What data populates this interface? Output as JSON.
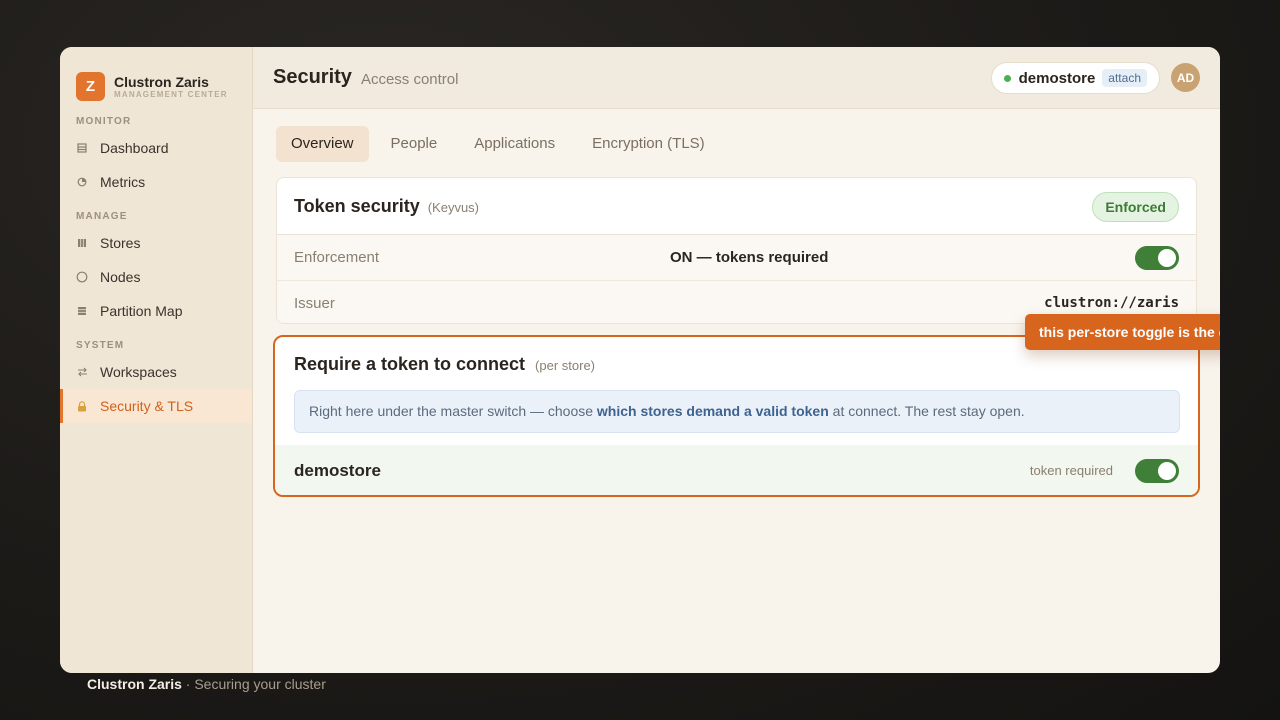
{
  "brand": {
    "logo_letter": "Z",
    "name": "Clustron Zaris",
    "subtitle": "MANAGEMENT CENTER"
  },
  "sidebar": {
    "sections": [
      {
        "label": "MONITOR"
      },
      {
        "label": "MANAGE"
      },
      {
        "label": "SYSTEM"
      }
    ],
    "items": [
      {
        "label": "Dashboard",
        "icon": "dashboard-icon"
      },
      {
        "label": "Metrics",
        "icon": "metrics-icon"
      },
      {
        "label": "Stores",
        "icon": "stores-icon"
      },
      {
        "label": "Nodes",
        "icon": "nodes-icon"
      },
      {
        "label": "Partition Map",
        "icon": "partition-map-icon"
      },
      {
        "label": "Workspaces",
        "icon": "workspaces-icon"
      },
      {
        "label": "Security & TLS",
        "icon": "lock-icon",
        "active": true
      }
    ]
  },
  "header": {
    "title": "Security",
    "subtitle": "Access control",
    "store": {
      "name": "demostore",
      "action": "attach",
      "status_color": "#4cb050"
    },
    "avatar_initials": "AD"
  },
  "tabs": [
    {
      "label": "Overview",
      "active": true
    },
    {
      "label": "People"
    },
    {
      "label": "Applications"
    },
    {
      "label": "Encryption (TLS)"
    }
  ],
  "token_card": {
    "title": "Token security",
    "tag": "(Keyvus)",
    "badge": "Enforced",
    "enforcement_label": "Enforcement",
    "enforcement_value": "ON — tokens required",
    "enforcement_on": true,
    "issuer_label": "Issuer",
    "issuer_value": "clustron://zaris"
  },
  "require_card": {
    "title": "Require a token to connect",
    "tag": "(per store)",
    "info_prefix": "Right here under the master switch — choose ",
    "info_bold": "which stores demand a valid token",
    "info_suffix": " at connect. The rest stay open.",
    "store_name": "demostore",
    "store_status": "token required",
    "store_on": true
  },
  "callout": {
    "text": "this per-store toggle is the data-plane switch",
    "arrow": "▸"
  },
  "footer": {
    "brand": "Clustron Zaris",
    "caption": " · Securing your cluster"
  },
  "colors": {
    "accent": "#e2742e",
    "toggle_on": "#3f7f37",
    "enforced": "#3e7b36"
  }
}
